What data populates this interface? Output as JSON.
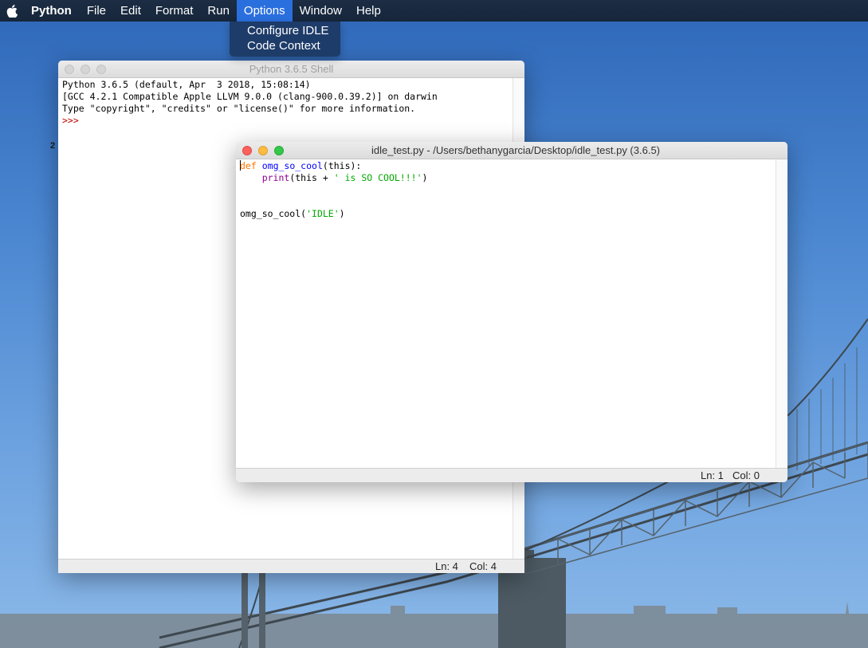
{
  "menubar": {
    "app_name": "Python",
    "items": [
      "File",
      "Edit",
      "Format",
      "Run",
      "Options",
      "Window",
      "Help"
    ],
    "active": "Options",
    "apple_icon": "apple-logo-icon"
  },
  "options_menu": {
    "items": [
      "Configure IDLE",
      "Code Context"
    ]
  },
  "shell_window": {
    "title": "Python 3.6.5 Shell",
    "lines": [
      "Python 3.6.5 (default, Apr  3 2018, 15:08:14)",
      "[GCC 4.2.1 Compatible Apple LLVM 9.0.0 (clang-900.0.39.2)] on darwin",
      "Type \"copyright\", \"credits\" or \"license()\" for more information."
    ],
    "prompt": ">>>",
    "status_ln": "Ln: 4",
    "status_col": "Col: 4"
  },
  "editor_window": {
    "title": "idle_test.py - /Users/bethanygarcia/Desktop/idle_test.py (3.6.5)",
    "code": {
      "line1_kw": "def",
      "line1_fn": "omg_so_cool",
      "line1_rest": "(this):",
      "line2_indent": "    ",
      "line2_builtin": "print",
      "line2_mid": "(this + ",
      "line2_str": "' is SO COOL!!!'",
      "line2_end": ")",
      "line5_call": "omg_so_cool(",
      "line5_str": "'IDLE'",
      "line5_end": ")"
    },
    "status_ln": "Ln: 1",
    "status_col": "Col: 0"
  },
  "desktop_fragment": "2",
  "colors": {
    "menubar_bg": "#16263b",
    "menu_active": "#2a6fde",
    "keyword": "#ff7700",
    "function": "#0000ff",
    "builtin": "#900090",
    "string": "#00aa00",
    "prompt": "#c00000"
  }
}
